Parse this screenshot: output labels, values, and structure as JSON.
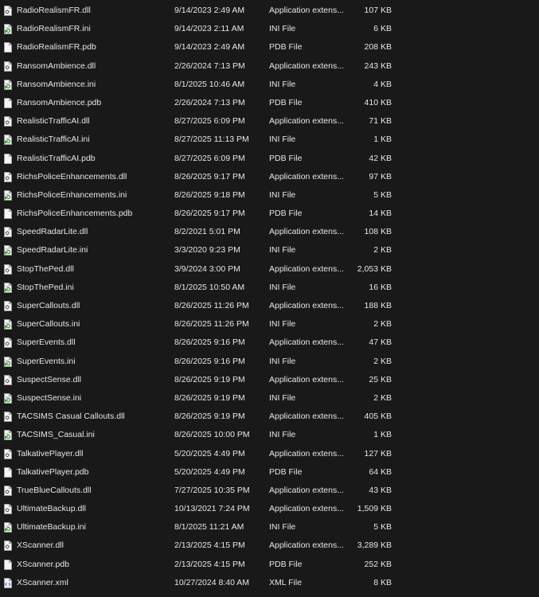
{
  "files": [
    {
      "name": "RadioRealismFR.dll",
      "date": "9/14/2023 2:49 AM",
      "type": "Application extens...",
      "size": "107 KB",
      "icon": "dll-file-icon"
    },
    {
      "name": "RadioRealismFR.ini",
      "date": "9/14/2023 2:11 AM",
      "type": "INI File",
      "size": "6 KB",
      "icon": "ini-file-icon"
    },
    {
      "name": "RadioRealismFR.pdb",
      "date": "9/14/2023 2:49 AM",
      "type": "PDB File",
      "size": "208 KB",
      "icon": "blank-file-icon"
    },
    {
      "name": "RansomAmbience.dll",
      "date": "2/26/2024 7:13 PM",
      "type": "Application extens...",
      "size": "243 KB",
      "icon": "dll-file-icon"
    },
    {
      "name": "RansomAmbience.ini",
      "date": "8/1/2025 10:46 AM",
      "type": "INI File",
      "size": "4 KB",
      "icon": "ini-file-icon"
    },
    {
      "name": "RansomAmbience.pdb",
      "date": "2/26/2024 7:13 PM",
      "type": "PDB File",
      "size": "410 KB",
      "icon": "blank-file-icon"
    },
    {
      "name": "RealisticTrafficAI.dll",
      "date": "8/27/2025 6:09 PM",
      "type": "Application extens...",
      "size": "71 KB",
      "icon": "dll-file-icon"
    },
    {
      "name": "RealisticTrafficAI.ini",
      "date": "8/27/2025 11:13 PM",
      "type": "INI File",
      "size": "1 KB",
      "icon": "ini-file-icon"
    },
    {
      "name": "RealisticTrafficAI.pdb",
      "date": "8/27/2025 6:09 PM",
      "type": "PDB File",
      "size": "42 KB",
      "icon": "blank-file-icon"
    },
    {
      "name": "RichsPoliceEnhancements.dll",
      "date": "8/26/2025 9:17 PM",
      "type": "Application extens...",
      "size": "97 KB",
      "icon": "dll-file-icon"
    },
    {
      "name": "RichsPoliceEnhancements.ini",
      "date": "8/26/2025 9:18 PM",
      "type": "INI File",
      "size": "5 KB",
      "icon": "ini-file-icon"
    },
    {
      "name": "RichsPoliceEnhancements.pdb",
      "date": "8/26/2025 9:17 PM",
      "type": "PDB File",
      "size": "14 KB",
      "icon": "blank-file-icon"
    },
    {
      "name": "SpeedRadarLite.dll",
      "date": "8/2/2021 5:01 PM",
      "type": "Application extens...",
      "size": "108 KB",
      "icon": "dll-file-icon"
    },
    {
      "name": "SpeedRadarLite.ini",
      "date": "3/3/2020 9:23 PM",
      "type": "INI File",
      "size": "2 KB",
      "icon": "ini-file-icon"
    },
    {
      "name": "StopThePed.dll",
      "date": "3/9/2024 3:00 PM",
      "type": "Application extens...",
      "size": "2,053 KB",
      "icon": "dll-file-icon"
    },
    {
      "name": "StopThePed.ini",
      "date": "8/1/2025 10:50 AM",
      "type": "INI File",
      "size": "16 KB",
      "icon": "ini-file-icon"
    },
    {
      "name": "SuperCallouts.dll",
      "date": "8/26/2025 11:26 PM",
      "type": "Application extens...",
      "size": "188 KB",
      "icon": "dll-file-icon"
    },
    {
      "name": "SuperCallouts.ini",
      "date": "8/26/2025 11:26 PM",
      "type": "INI File",
      "size": "2 KB",
      "icon": "ini-file-icon"
    },
    {
      "name": "SuperEvents.dll",
      "date": "8/26/2025 9:16 PM",
      "type": "Application extens...",
      "size": "47 KB",
      "icon": "dll-file-icon"
    },
    {
      "name": "SuperEvents.ini",
      "date": "8/26/2025 9:16 PM",
      "type": "INI File",
      "size": "2 KB",
      "icon": "ini-file-icon"
    },
    {
      "name": "SuspectSense.dll",
      "date": "8/26/2025 9:19 PM",
      "type": "Application extens...",
      "size": "25 KB",
      "icon": "dll-file-icon"
    },
    {
      "name": "SuspectSense.ini",
      "date": "8/26/2025 9:19 PM",
      "type": "INI File",
      "size": "2 KB",
      "icon": "ini-file-icon"
    },
    {
      "name": "TACSIMS Casual Callouts.dll",
      "date": "8/26/2025 9:19 PM",
      "type": "Application extens...",
      "size": "405 KB",
      "icon": "dll-file-icon"
    },
    {
      "name": "TACSIMS_Casual.ini",
      "date": "8/26/2025 10:00 PM",
      "type": "INI File",
      "size": "1 KB",
      "icon": "ini-file-icon"
    },
    {
      "name": "TalkativePlayer.dll",
      "date": "5/20/2025 4:49 PM",
      "type": "Application extens...",
      "size": "127 KB",
      "icon": "dll-file-icon"
    },
    {
      "name": "TalkativePlayer.pdb",
      "date": "5/20/2025 4:49 PM",
      "type": "PDB File",
      "size": "64 KB",
      "icon": "blank-file-icon"
    },
    {
      "name": "TrueBlueCallouts.dll",
      "date": "7/27/2025 10:35 PM",
      "type": "Application extens...",
      "size": "43 KB",
      "icon": "dll-file-icon"
    },
    {
      "name": "UltimateBackup.dll",
      "date": "10/13/2021 7:24 PM",
      "type": "Application extens...",
      "size": "1,509 KB",
      "icon": "dll-file-icon"
    },
    {
      "name": "UltimateBackup.ini",
      "date": "8/1/2025 11:21 AM",
      "type": "INI File",
      "size": "5 KB",
      "icon": "ini-file-icon"
    },
    {
      "name": "XScanner.dll",
      "date": "2/13/2025 4:15 PM",
      "type": "Application extens...",
      "size": "3,289 KB",
      "icon": "dll-file-icon"
    },
    {
      "name": "XScanner.pdb",
      "date": "2/13/2025 4:15 PM",
      "type": "PDB File",
      "size": "252 KB",
      "icon": "blank-file-icon"
    },
    {
      "name": "XScanner.xml",
      "date": "10/27/2024 8:40 AM",
      "type": "XML File",
      "size": "8 KB",
      "icon": "xml-file-icon"
    }
  ]
}
